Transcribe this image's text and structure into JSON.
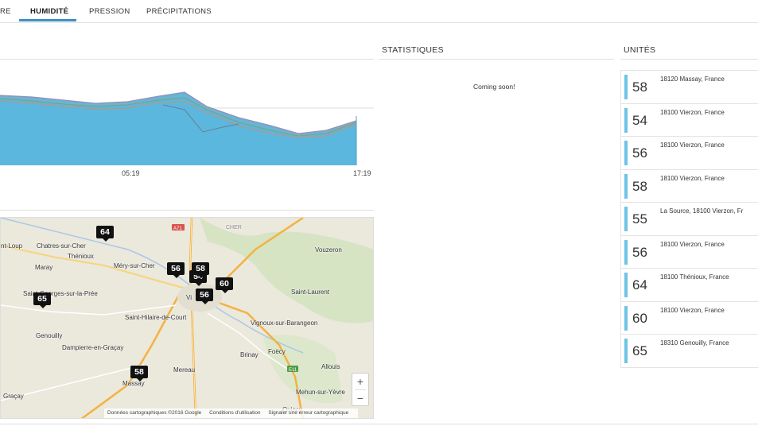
{
  "tabs": [
    {
      "label": "RE"
    },
    {
      "label": "HUMIDITÉ"
    },
    {
      "label": "PRESSION"
    },
    {
      "label": "PRÉCIPITATIONS"
    }
  ],
  "chart_data": {
    "type": "area",
    "x_ticks": [
      "05:19",
      "17:19"
    ],
    "series_count": 9,
    "colors": {
      "fill": "#5bb7de",
      "lines": [
        "#9b8fb5",
        "#7aa66e",
        "#c98f7b",
        "#8fa9c4",
        "#6c7f95"
      ]
    }
  },
  "map": {
    "places": [
      "nt-Loup",
      "Chatres-sur-Cher",
      "Thénioux",
      "Méry-sur-Cher",
      "Maray",
      "Saint-Georges-sur-la-Prée",
      "Saint-Hilaire-de-Court",
      "Genouilly",
      "Dampierre-en-Graçay",
      "Mereau",
      "Massay",
      "Graçay",
      "Vouzeron",
      "Saint-Laurent",
      "Vignoux-sur-Barangeon",
      "Brinay",
      "Foëcy",
      "Allouis",
      "Mehun-sur-Yèvre",
      "Quincy",
      "Vi",
      "CHER",
      "A71",
      "E11"
    ],
    "markers": [
      "64",
      "56",
      "58",
      "54",
      "60",
      "65",
      "56",
      "58"
    ],
    "zoom_in": "+",
    "zoom_out": "−",
    "footer": {
      "data": "Données cartographiques ©2016 Google",
      "terms": "Conditions d'utilisation",
      "report": "Signaler une erreur cartographique"
    }
  },
  "statistics": {
    "title": "STATISTIQUES",
    "message": "Coming soon!"
  },
  "units": {
    "title": "UNITÉS",
    "items": [
      {
        "value": "58",
        "location": "18120 Massay, France"
      },
      {
        "value": "54",
        "location": "18100 Vierzon, France"
      },
      {
        "value": "56",
        "location": "18100 Vierzon, France"
      },
      {
        "value": "58",
        "location": "18100 Vierzon, France"
      },
      {
        "value": "55",
        "location": "La Source, 18100 Vierzon, Fr"
      },
      {
        "value": "56",
        "location": "18100 Vierzon, France"
      },
      {
        "value": "64",
        "location": "18100 Thénioux, France"
      },
      {
        "value": "60",
        "location": "18100 Vierzon, France"
      },
      {
        "value": "65",
        "location": "18310 Genouilly, France"
      }
    ]
  }
}
